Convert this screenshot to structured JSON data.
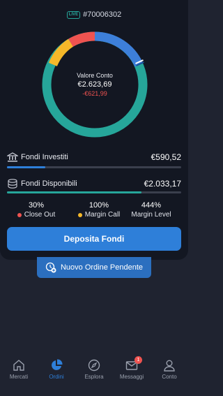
{
  "account": {
    "live_badge": "LIVE",
    "id": "#70006302"
  },
  "summary": {
    "label": "Valore Conto",
    "value": "€2.623,69",
    "delta": "-€621,99",
    "ring_colors": [
      "#3d7fd9",
      "#ef5350",
      "#f5b829",
      "#26a69a"
    ]
  },
  "funds": {
    "invested": {
      "label": "Fondi Investiti",
      "value": "€590,52",
      "fill_fraction": 0.22,
      "color": "#2e7fd9"
    },
    "available": {
      "label": "Fondi Disponibili",
      "value": "€2.033,17",
      "fill_fraction": 0.77,
      "color": "#26a69a"
    }
  },
  "stats": [
    {
      "value": "30%",
      "label": "Close Out",
      "color": "#ef5350"
    },
    {
      "value": "100%",
      "label": "Margin Call",
      "color": "#f5b829"
    },
    {
      "value": "444%",
      "label": "Margin Level",
      "color": ""
    }
  ],
  "deposit_label": "Deposita Fondi",
  "new_order_label": "Nuovo Ordine Pendente",
  "tabs": [
    {
      "label": "Mercati",
      "icon": "home-icon",
      "active": false
    },
    {
      "label": "Ordini",
      "icon": "pie-chart-icon",
      "active": true
    },
    {
      "label": "Esplora",
      "icon": "compass-icon",
      "active": false
    },
    {
      "label": "Messaggi",
      "icon": "mail-icon",
      "active": false,
      "badge": "1"
    },
    {
      "label": "Conto",
      "icon": "user-icon",
      "active": false
    }
  ]
}
